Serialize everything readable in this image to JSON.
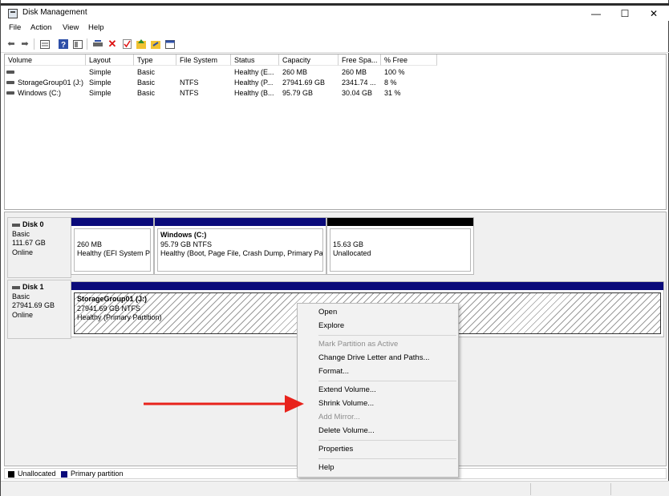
{
  "window": {
    "title": "Disk Management",
    "minimize": "—",
    "maximize": "☐",
    "close": "✕"
  },
  "menu": [
    "File",
    "Action",
    "View",
    "Help"
  ],
  "toolbar_icons": [
    "back-icon",
    "forward-icon",
    "properties-icon",
    "help-icon",
    "show-pane-icon",
    "connect-icon",
    "delete-icon",
    "check-icon",
    "up-icon",
    "refresh-icon",
    "console-icon"
  ],
  "volume_list": {
    "columns": [
      "Volume",
      "Layout",
      "Type",
      "File System",
      "Status",
      "Capacity",
      "Free Spa...",
      "% Free"
    ],
    "rows": [
      {
        "volume": "",
        "layout": "Simple",
        "type": "Basic",
        "fs": "",
        "status": "Healthy (E...",
        "capacity": "260 MB",
        "free": "260 MB",
        "pct": "100 %"
      },
      {
        "volume": "StorageGroup01 (J:)",
        "layout": "Simple",
        "type": "Basic",
        "fs": "NTFS",
        "status": "Healthy (P...",
        "capacity": "27941.69 GB",
        "free": "2341.74 ...",
        "pct": "8 %"
      },
      {
        "volume": "Windows (C:)",
        "layout": "Simple",
        "type": "Basic",
        "fs": "NTFS",
        "status": "Healthy (B...",
        "capacity": "95.79 GB",
        "free": "30.04 GB",
        "pct": "31 %"
      }
    ]
  },
  "disks": [
    {
      "name": "Disk 0",
      "type": "Basic",
      "size": "111.67 GB",
      "state": "Online",
      "partitions": [
        {
          "title": "",
          "size": "260 MB",
          "status": "Healthy (EFI System Pa",
          "bar_color": "#0a0a7a"
        },
        {
          "title": "Windows  (C:)",
          "size": "95.79 GB NTFS",
          "status": "Healthy (Boot, Page File, Crash Dump, Primary Pa",
          "bar_color": "#0a0a7a"
        },
        {
          "title": "",
          "size": "15.63 GB",
          "status": "Unallocated",
          "bar_color": "#000000"
        }
      ]
    },
    {
      "name": "Disk 1",
      "type": "Basic",
      "size": "27941.69 GB",
      "state": "Online",
      "partitions": [
        {
          "title": "StorageGroup01  (J:)",
          "size": "27941.69 GB NTFS",
          "status": "Healthy (Primary Partition)",
          "bar_color": "#0a0a7a"
        }
      ]
    }
  ],
  "legend": [
    {
      "label": "Unallocated",
      "color": "#000000"
    },
    {
      "label": "Primary partition",
      "color": "#0a0a7a"
    }
  ],
  "context_menu": {
    "items": [
      {
        "label": "Open",
        "enabled": true
      },
      {
        "label": "Explore",
        "enabled": true
      },
      {
        "label": "Mark Partition as Active",
        "enabled": false
      },
      {
        "label": "Change Drive Letter and Paths...",
        "enabled": true
      },
      {
        "label": "Format...",
        "enabled": true
      },
      {
        "label": "Extend Volume...",
        "enabled": true
      },
      {
        "label": "Shrink Volume...",
        "enabled": true
      },
      {
        "label": "Add Mirror...",
        "enabled": false
      },
      {
        "label": "Delete Volume...",
        "enabled": true
      },
      {
        "label": "Properties",
        "enabled": true
      },
      {
        "label": "Help",
        "enabled": true
      }
    ]
  },
  "annotation": {
    "color": "#e8231c"
  }
}
